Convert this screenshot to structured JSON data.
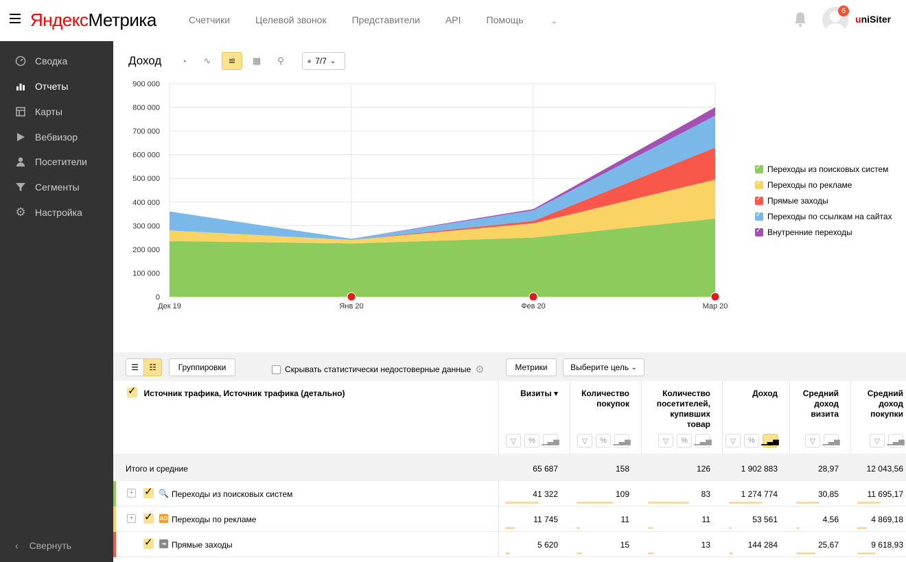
{
  "app": {
    "logo_yandex": "Яндекс",
    "logo_product": "Метрика",
    "nav": [
      "Счетчики",
      "Целевой звонок",
      "Представители",
      "API",
      "Помощь"
    ],
    "notification_count": "6",
    "user_first": "u",
    "user_rest": "niSiter"
  },
  "sidebar": {
    "items": [
      {
        "label": "Сводка",
        "icon": "dashboard-icon"
      },
      {
        "label": "Отчеты",
        "icon": "bar-chart-icon",
        "active": true
      },
      {
        "label": "Карты",
        "icon": "map-grid-icon"
      },
      {
        "label": "Вебвизор",
        "icon": "play-icon"
      },
      {
        "label": "Посетители",
        "icon": "person-icon"
      },
      {
        "label": "Сегменты",
        "icon": "filter-icon"
      },
      {
        "label": "Настройка",
        "icon": "gear-icon"
      }
    ],
    "collapse_label": "Свернуть"
  },
  "chart_header": {
    "title": "Доход",
    "series_selector": "7/7"
  },
  "chart_data": {
    "type": "area",
    "stacked": true,
    "x": [
      "Дек 19",
      "Янв 20",
      "Фев 20",
      "Мар 20"
    ],
    "ylim": [
      0,
      900000
    ],
    "yticks": [
      "0",
      "100 000",
      "200 000",
      "300 000",
      "400 000",
      "500 000",
      "600 000",
      "700 000",
      "800 000",
      "900 000"
    ],
    "series": [
      {
        "name": "Переходы из поисковых систем",
        "color": "#8ccb5c",
        "values": [
          235000,
          225000,
          250000,
          330000
        ]
      },
      {
        "name": "Переходы по рекламе",
        "color": "#f9d465",
        "values": [
          45000,
          15000,
          60000,
          165000
        ]
      },
      {
        "name": "Прямые заходы",
        "color": "#f8574a",
        "values": [
          0,
          0,
          10000,
          135000
        ]
      },
      {
        "name": "Переходы по ссылкам на сайтах",
        "color": "#7ab8ea",
        "values": [
          80000,
          5000,
          45000,
          135000
        ]
      },
      {
        "name": "Внутренние переходы",
        "color": "#a44fb4",
        "values": [
          0,
          0,
          5000,
          35000
        ]
      }
    ],
    "grid": true,
    "legend": "right"
  },
  "toolbar": {
    "groupings": "Группировки",
    "hide_label": "Скрывать статистически недостоверные данные",
    "metrics": "Метрики",
    "goal": "Выберите цель"
  },
  "table": {
    "dimension_header": "Источник трафика, Источник трафика (детально)",
    "columns": [
      {
        "lines": [
          "Визиты ▾"
        ]
      },
      {
        "lines": [
          "Количество",
          "покупок"
        ]
      },
      {
        "lines": [
          "Количество",
          "посетителей,",
          "купивших",
          "товар"
        ]
      },
      {
        "lines": [
          "Доход"
        ]
      },
      {
        "lines": [
          "Средний",
          "доход",
          "визита"
        ]
      },
      {
        "lines": [
          "Средний",
          "доход",
          "покупки"
        ]
      }
    ],
    "totals": {
      "label": "Итого и средние",
      "values": [
        "65 687",
        "158",
        "126",
        "1 902 883",
        "28,97",
        "12 043,56"
      ]
    },
    "rows": [
      {
        "name": "Переходы из поисковых систем",
        "icon": "search-icon",
        "color": "#8ccb5c",
        "values": [
          "41 322",
          "109",
          "83",
          "1 274 774",
          "30,85",
          "11 695,17"
        ],
        "shares": [
          0.63,
          0.69,
          0.66,
          0.67,
          0.55,
          0.5
        ],
        "expandable": true
      },
      {
        "name": "Переходы по рекламе",
        "icon": "ad-icon",
        "color": "#f9d465",
        "values": [
          "11 745",
          "11",
          "11",
          "53 561",
          "4,56",
          "4 869,18"
        ],
        "shares": [
          0.18,
          0.07,
          0.09,
          0.03,
          0.08,
          0.21
        ],
        "expandable": true
      },
      {
        "name": "Прямые заходы",
        "icon": "direct-icon",
        "color": "#f8574a",
        "values": [
          "5 620",
          "15",
          "13",
          "144 284",
          "25,67",
          "9 618,93"
        ],
        "shares": [
          0.09,
          0.1,
          0.1,
          0.08,
          0.45,
          0.41
        ],
        "expandable": false
      }
    ]
  }
}
